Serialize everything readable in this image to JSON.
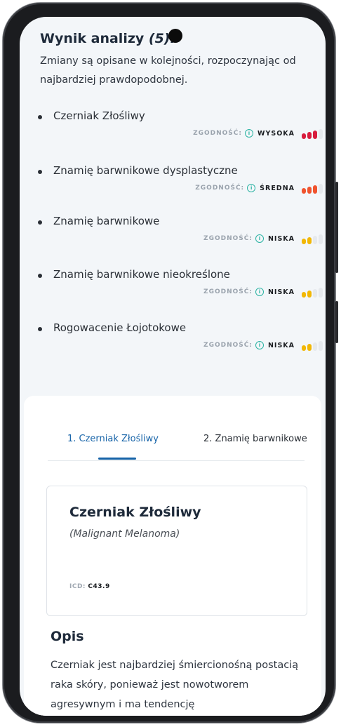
{
  "header": {
    "title": "Wynik analizy",
    "count": "(5):"
  },
  "intro": "Zmiany są opisane w kolejności, rozpoczynając od najbardziej prawdopodobnej.",
  "match_label": "ZGODNOŚĆ:",
  "info_glyph": "i",
  "diagnoses": [
    {
      "name": "Czerniak Złośliwy",
      "level": "WYSOKA",
      "filled": 3,
      "color": "#d81b3c"
    },
    {
      "name": "Znamię barwnikowe dysplastyczne",
      "level": "ŚREDNA",
      "filled": 3,
      "color": "#f0532e"
    },
    {
      "name": "Znamię barwnikowe",
      "level": "NISKA",
      "filled": 2,
      "color": "#f2b705"
    },
    {
      "name": "Znamię barwnikowe nieokreślone",
      "level": "NISKA",
      "filled": 2,
      "color": "#f2b705"
    },
    {
      "name": "Rogowacenie Łojotokowe",
      "level": "NISKA",
      "filled": 2,
      "color": "#f2b705"
    }
  ],
  "tabs": [
    {
      "label": "1. Czerniak Złośliwy",
      "active": true
    },
    {
      "label": "2. Znamię barwnikowe",
      "active": false
    }
  ],
  "detail": {
    "title": "Czerniak Złośliwy",
    "latin": "(Malignant Melanoma)",
    "icd_label": "ICD:",
    "icd_code": "C43.9"
  },
  "opis": {
    "title": "Opis",
    "text": "Czerniak jest najbardziej śmiercionośną postacią raka skóry, ponieważ jest nowotworem agresywnym i ma tendencję"
  },
  "colors": {
    "accent": "#1663a8",
    "empty_bar": "#e6e9ed",
    "info": "#2bb3a3"
  }
}
